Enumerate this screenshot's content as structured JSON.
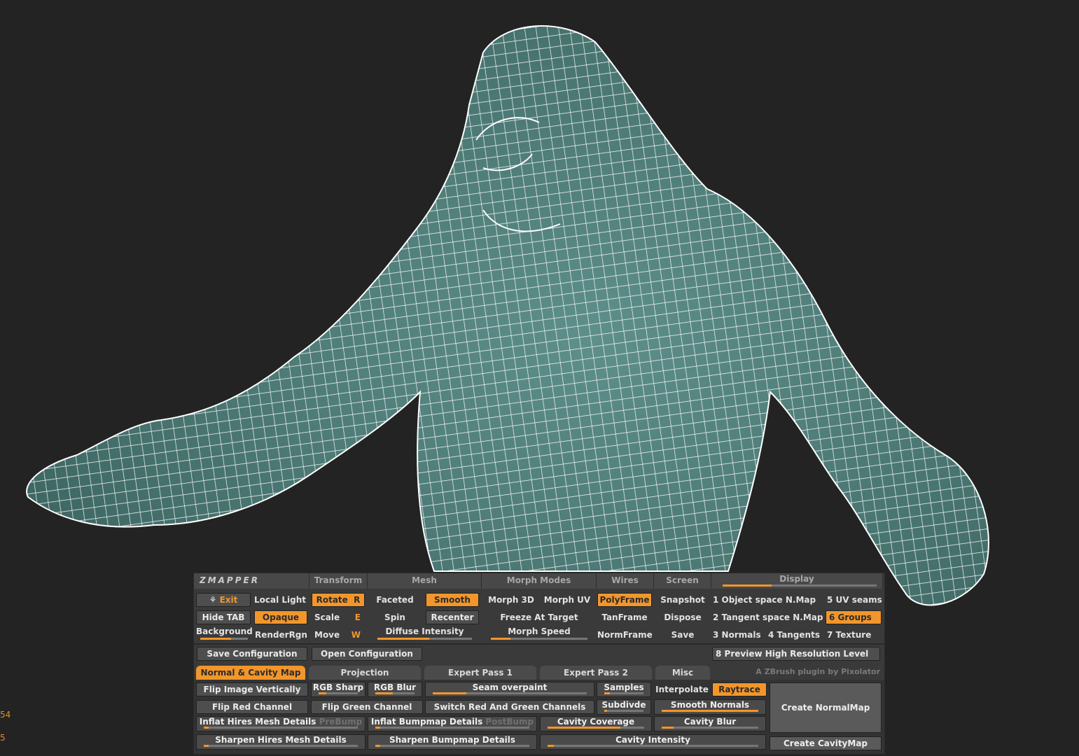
{
  "side_numbers": [
    "54",
    "5"
  ],
  "colors": {
    "accent": "#f2962c",
    "mesh": "#4f7c78",
    "wire": "#ffffff",
    "bg": "#232323"
  },
  "zmapper": {
    "logo": "ZMAPPER",
    "headers": {
      "transform": "Transform",
      "mesh": "Mesh",
      "morph_modes": "Morph Modes",
      "wires": "Wires",
      "screen": "Screen",
      "display": "Display"
    },
    "left": {
      "exit": "Exit",
      "local_light": "Local Light",
      "hide_tab": "Hide TAB",
      "opaque": "Opaque",
      "background": "Background",
      "render_rgn": "RenderRgn"
    },
    "transform": {
      "rotate": "Rotate",
      "rotate_key": "R",
      "scale": "Scale",
      "scale_key": "E",
      "move": "Move",
      "move_key": "W"
    },
    "mesh": {
      "faceted": "Faceted",
      "smooth": "Smooth",
      "spin": "Spin",
      "recenter": "Recenter",
      "diffuse_intensity": "Diffuse Intensity"
    },
    "morph": {
      "morph_3d": "Morph 3D",
      "morph_uv": "Morph UV",
      "freeze": "Freeze At Target",
      "morph_speed": "Morph Speed"
    },
    "wires": {
      "polyframe": "PolyFrame",
      "tanframe": "TanFrame",
      "normframe": "NormFrame"
    },
    "screen": {
      "snapshot": "Snapshot",
      "dispose": "Dispose",
      "save": "Save"
    },
    "display": {
      "d1": "1 Object space N.Map",
      "d5": "5 UV seams",
      "d2": "2 Tangent space N.Map",
      "d6": "6 Groups",
      "d3": "3 Normals",
      "d4": "4 Tangents",
      "d7": "7 Texture",
      "d8": "8 Preview High Resolution Level"
    },
    "config": {
      "save": "Save Configuration",
      "open": "Open Configuration"
    },
    "credit": "A ZBrush plugin by Pixolator",
    "tabs": [
      "Normal & Cavity Map",
      "Projection",
      "Expert Pass 1",
      "Expert Pass 2",
      "Misc"
    ],
    "options": {
      "flip_vert": "Flip Image Vertically",
      "rgb_sharp": "RGB Sharp",
      "rgb_blur": "RGB Blur",
      "seam_overpaint": "Seam overpaint",
      "samples": "Samples",
      "interpolate": "Interpolate",
      "raytrace": "Raytrace",
      "flip_red": "Flip Red Channel",
      "flip_green": "Flip Green Channel",
      "switch_rg": "Switch Red And Green Channels",
      "subdivide": "Subdivde",
      "smooth_normals": "Smooth Normals",
      "create_normalmap": "Create NormalMap",
      "inflat_hires": "Inflat Hires Mesh Details",
      "prebump": "PreBump",
      "inflat_bump": "Inflat Bumpmap Details",
      "postbump": "PostBump",
      "cavity_coverage": "Cavity Coverage",
      "cavity_blur": "Cavity Blur",
      "sharpen_hires": "Sharpen Hires Mesh Details",
      "sharpen_bump": "Sharpen Bumpmap Details",
      "cavity_intensity": "Cavity Intensity",
      "create_cavitymap": "Create CavityMap"
    }
  }
}
